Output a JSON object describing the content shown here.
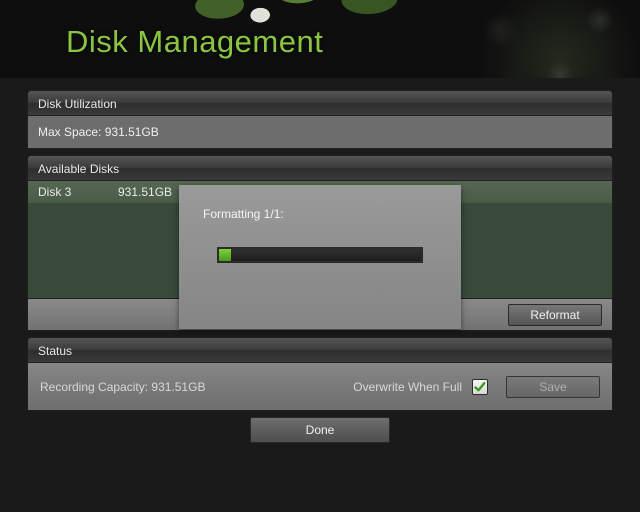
{
  "title": "Disk Management",
  "sections": {
    "utilization": {
      "heading": "Disk Utilization",
      "max_space_label": "Max Space:",
      "max_space_value": "931.51GB"
    },
    "disks": {
      "heading": "Available Disks",
      "reformat_label": "Reformat",
      "rows": [
        {
          "name": "Disk 3",
          "size": "931.51GB"
        }
      ]
    },
    "status": {
      "heading": "Status",
      "recording_capacity_label": "Recording Capacity:",
      "recording_capacity_value": "931.51GB",
      "overwrite_label": "Overwrite When Full",
      "overwrite_checked": true,
      "save_label": "Save"
    }
  },
  "done_label": "Done",
  "modal": {
    "label": "Formatting 1/1:",
    "progress_percent": 6
  },
  "colors": {
    "accent_green": "#8bc53f",
    "progress_green": "#6bc431"
  }
}
